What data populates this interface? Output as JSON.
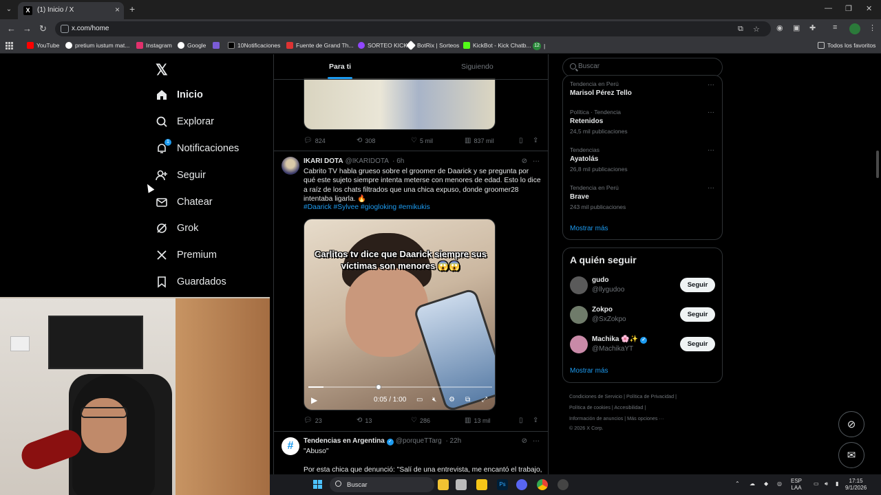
{
  "browser": {
    "tab_title": "(1) Inicio / X",
    "url": "x.com/home",
    "bookmarks": [
      {
        "label": "YouTube",
        "color": "#ff0000"
      },
      {
        "label": "pretium iustum mat...",
        "color": "#ffffff"
      },
      {
        "label": "Instagram",
        "color": "#e1306c"
      },
      {
        "label": "Google",
        "color": "#ffffff"
      },
      {
        "label": "",
        "color": "#7b5cd6"
      },
      {
        "label": "10Notificaciones",
        "color": "#000000"
      },
      {
        "label": "Fuente de Grand Th...",
        "color": "#d33"
      },
      {
        "label": "SORTEO KICK",
        "color": "#9146ff"
      },
      {
        "label": "BotRix | Sorteos",
        "color": "#ffffff"
      },
      {
        "label": "KickBot - Kick Chatb...",
        "color": "#53fc18"
      }
    ],
    "bookmark_badge": "12",
    "all_favorites": "Todos los favoritos"
  },
  "nav": {
    "items": [
      {
        "label": "Inicio",
        "icon": "home-icon"
      },
      {
        "label": "Explorar",
        "icon": "search-icon"
      },
      {
        "label": "Notificaciones",
        "icon": "bell-icon"
      },
      {
        "label": "Seguir",
        "icon": "person-add-icon"
      },
      {
        "label": "Chatear",
        "icon": "envelope-icon"
      },
      {
        "label": "Grok",
        "icon": "grok-icon"
      },
      {
        "label": "Premium",
        "icon": "x-icon"
      },
      {
        "label": "Guardados",
        "icon": "bookmark-icon"
      }
    ],
    "notif_count": "1"
  },
  "feed": {
    "tabs": [
      "Para ti",
      "Siguiendo"
    ],
    "prev_actions": {
      "replies": "824",
      "reposts": "308",
      "likes": "5 mil",
      "views": "837 mil"
    },
    "post": {
      "name": "IKARI DOTA",
      "handle": "@IKARIDOTA",
      "time": "· 6h",
      "text": "Cabrito TV habla grueso sobre el groomer de Daarick y se pregunta por qué este sujeto siempre intenta meterse con menores de edad. Esto lo dice a raíz de los chats filtrados que una chica expuso, donde groomer28 intentaba ligarla. 🔥",
      "hashtags": "#Daarick #Sylvee #giogloking #emikukis",
      "video_caption": "Carlitos tv dice que Daarick siempre sus víctimas son menores 😱😱",
      "video_time": "0:05 / 1:00",
      "video_progress": 0.083,
      "actions": {
        "replies": "23",
        "reposts": "13",
        "likes": "286",
        "views": "13 mil"
      }
    },
    "next_post": {
      "name": "Tendencias en Argentina",
      "handle": "@porqueTTarg",
      "time": "· 22h",
      "line1": "\"Abuso\"",
      "line2": "Por esta chica que denunció: \"Salí de una entrevista, me encantó el trabajo,"
    }
  },
  "right": {
    "search_placeholder": "Buscar",
    "trends": [
      {
        "category": "Tendencia en Perú",
        "title": "Marisol Pérez Tello",
        "count": ""
      },
      {
        "category": "Política · Tendencia",
        "title": "Retenidos",
        "count": "24,5 mil publicaciones"
      },
      {
        "category": "Tendencias",
        "title": "Ayatolás",
        "count": "26,8 mil publicaciones"
      },
      {
        "category": "Tendencia en Perú",
        "title": "Brave",
        "count": "243 mil publicaciones"
      }
    ],
    "show_more": "Mostrar más",
    "who_to_follow_title": "A quién seguir",
    "who_to_follow": [
      {
        "name": "gudo",
        "handle": "@llygudoo",
        "color": "#666"
      },
      {
        "name": "Zokpo",
        "handle": "@SxZokpo",
        "color": "#556b55"
      },
      {
        "name": "Machika 🌸✨",
        "handle": "@MachikaYT",
        "color": "#c98aa8"
      }
    ],
    "follow_label": "Seguir",
    "footer": [
      "Condiciones de Servicio  |  Política de Privacidad  |",
      "Política de cookies  |  Accesibilidad  |",
      "Información de anuncios  |  Más opciones ···",
      "© 2026 X Corp."
    ]
  },
  "taskbar": {
    "search": "Buscar",
    "lang": "ESP",
    "lang2": "LAA",
    "time": "17:15",
    "date": "9/1/2026"
  }
}
